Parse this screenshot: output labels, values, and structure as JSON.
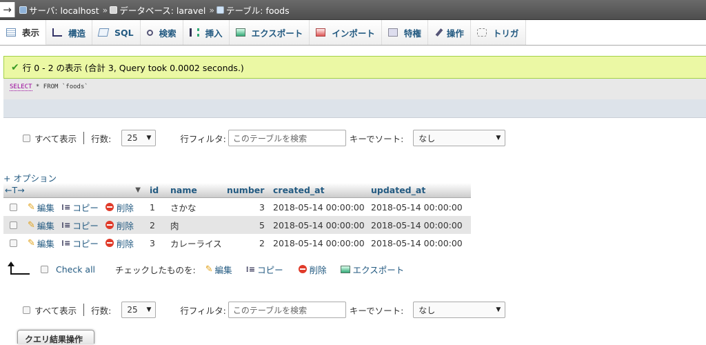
{
  "breadcrumb": {
    "back_glyph": "→",
    "server": "サーバ: localhost",
    "database": "データベース: laravel",
    "table": "テーブル: foods",
    "separator": "»"
  },
  "tabs": [
    {
      "label": "表示",
      "icon": "browse-icon"
    },
    {
      "label": "構造",
      "icon": "structure-icon"
    },
    {
      "label": "SQL",
      "icon": "sql-icon"
    },
    {
      "label": "検索",
      "icon": "search-icon"
    },
    {
      "label": "挿入",
      "icon": "insert-icon"
    },
    {
      "label": "エクスポート",
      "icon": "export-icon"
    },
    {
      "label": "インポート",
      "icon": "import-icon"
    },
    {
      "label": "特権",
      "icon": "privileges-icon"
    },
    {
      "label": "操作",
      "icon": "wrench-icon"
    },
    {
      "label": "トリガ",
      "icon": "triggers-icon"
    }
  ],
  "message": "行 0 - 2 の表示 (合計 3, Query took 0.0002 seconds.)",
  "sql": {
    "select": "SELECT",
    "rest": " * FROM `foods`"
  },
  "nav": {
    "show_all": "すべて表示",
    "rows_label": "行数:",
    "rows_value": "25",
    "filter_label": "行フィルタ:",
    "filter_placeholder": "このテーブルを検索",
    "sort_label": "キーでソート:",
    "sort_value": "なし"
  },
  "options_link": "+ オプション",
  "table": {
    "col_arrows": "←T→",
    "headers": [
      "id",
      "name",
      "number",
      "created_at",
      "updated_at"
    ],
    "actions": {
      "edit": "編集",
      "copy": "コピー",
      "delete": "削除"
    },
    "rows": [
      [
        "1",
        "さかな",
        "3",
        "2018-05-14 00:00:00",
        "2018-05-14 00:00:00"
      ],
      [
        "2",
        "肉",
        "5",
        "2018-05-14 00:00:00",
        "2018-05-14 00:00:00"
      ],
      [
        "3",
        "カレーライス",
        "2",
        "2018-05-14 00:00:00",
        "2018-05-14 00:00:00"
      ]
    ]
  },
  "bulk": {
    "check_all": "Check all",
    "with_selected": "チェックしたものを:",
    "edit": "編集",
    "copy": "コピー",
    "delete": "削除",
    "export": "エクスポート"
  },
  "query_results_tab": "クエリ結果操作"
}
